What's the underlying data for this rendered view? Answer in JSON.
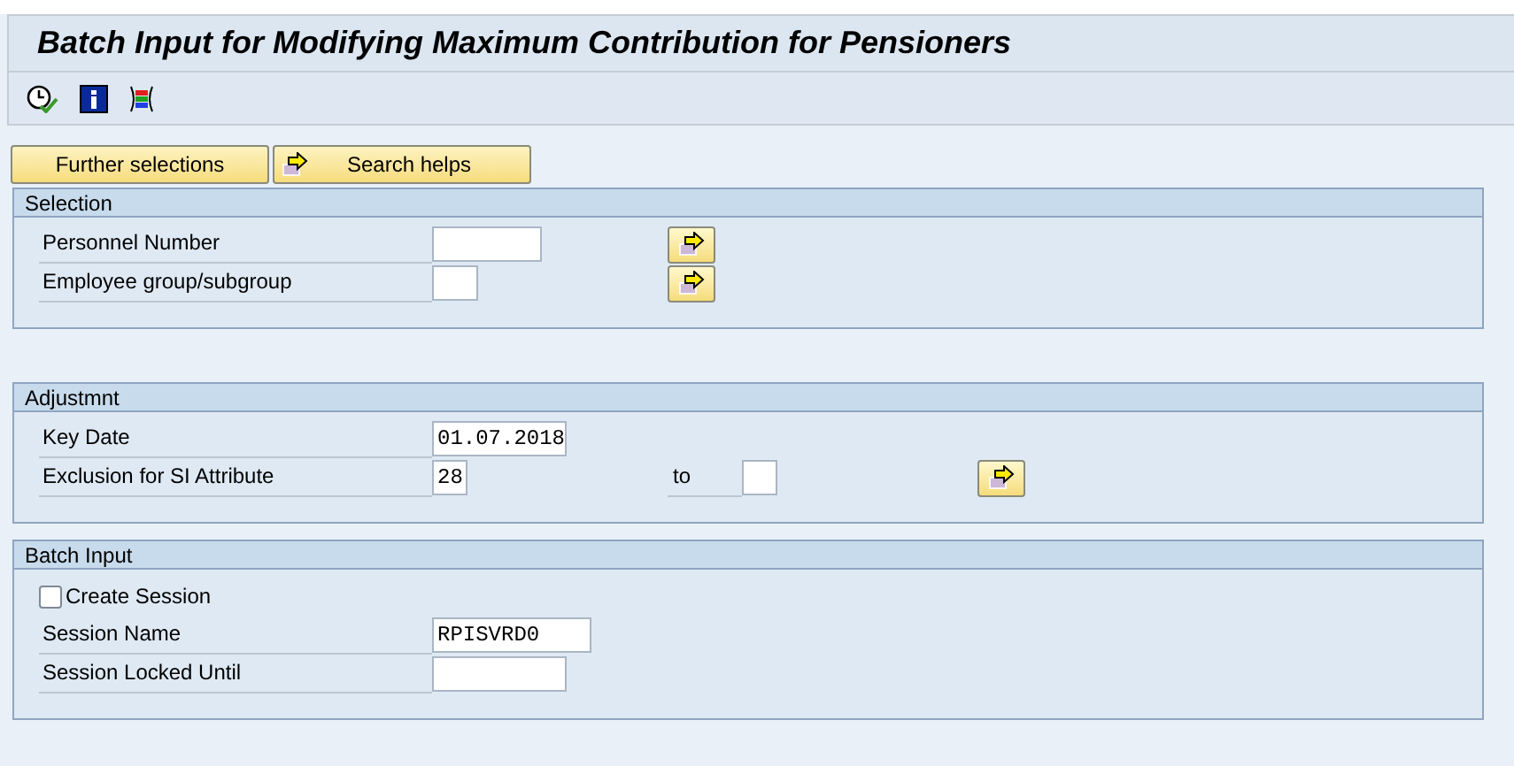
{
  "title": "Batch Input for Modifying Maximum Contribution for Pensioners",
  "buttons": [
    {
      "label": "Further selections",
      "icon": false
    },
    {
      "label": "Search helps",
      "icon": true
    }
  ],
  "sections": [
    {
      "title": "Selection",
      "rows": [
        {
          "kind": "field",
          "label": "Personnel Number",
          "value": "",
          "multiple": true
        },
        {
          "kind": "field",
          "label": "Employee group/subgroup",
          "value": "",
          "multiple": true
        }
      ]
    },
    {
      "title": "Adjustmnt",
      "rows": [
        {
          "kind": "field",
          "label": "Key Date",
          "value": "01.07.2018",
          "multiple": false
        },
        {
          "kind": "range",
          "label": "Exclusion for SI Attribute",
          "value": "28",
          "to_label": "to",
          "to_value": "",
          "multiple": true
        }
      ]
    },
    {
      "title": "Batch Input",
      "rows": [
        {
          "kind": "checkbox",
          "label": "Create Session",
          "checked": false
        },
        {
          "kind": "field",
          "label": "Session Name",
          "value": "RPISVRD0",
          "multiple": false
        },
        {
          "kind": "field",
          "label": "Session Locked Until",
          "value": "",
          "multiple": false
        }
      ]
    }
  ]
}
